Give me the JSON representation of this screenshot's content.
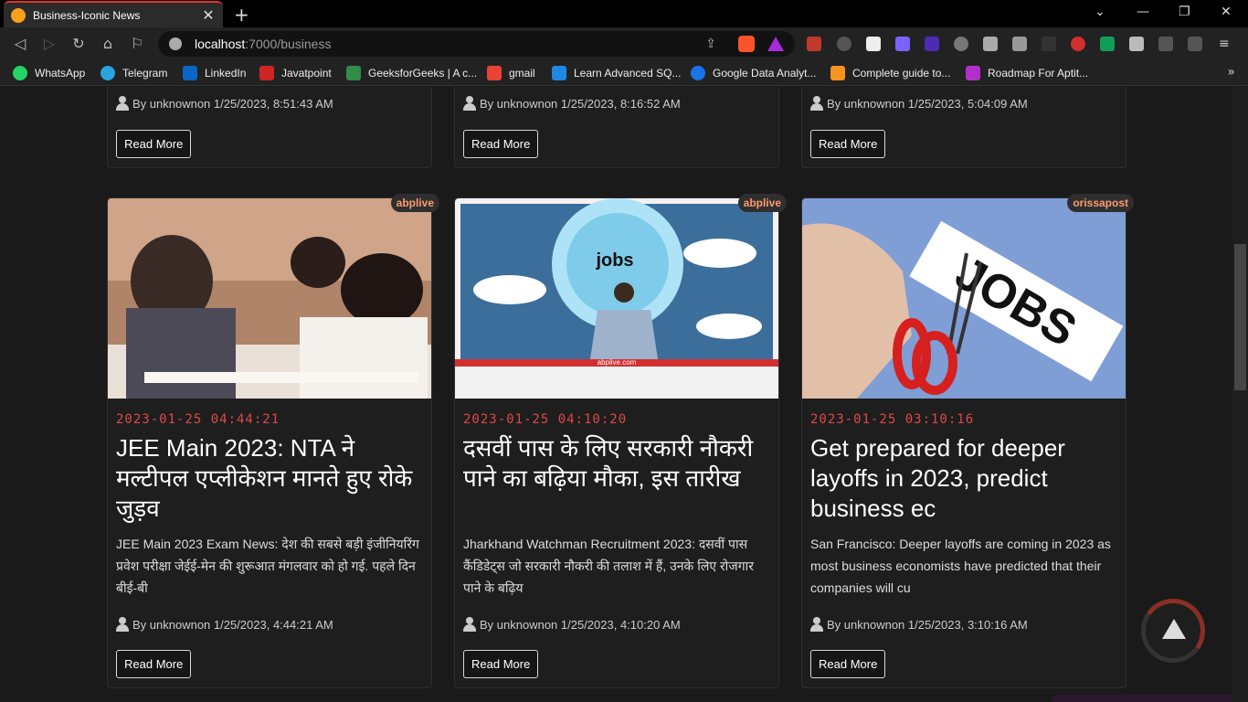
{
  "browser": {
    "tab_title": "Business-Iconic News",
    "url_host": "localhost",
    "url_path": ":7000/business",
    "bookmarks": [
      {
        "label": "WhatsApp",
        "color": "#25d366"
      },
      {
        "label": "Telegram",
        "color": "#2aa3e0"
      },
      {
        "label": "LinkedIn",
        "color": "#0a66c2"
      },
      {
        "label": "Javatpoint",
        "color": "#d02424"
      },
      {
        "label": "GeeksforGeeks | A c...",
        "color": "#2f8d46"
      },
      {
        "label": "gmail",
        "color": "#ea4335"
      },
      {
        "label": "Learn Advanced SQ...",
        "color": "#1e88e5"
      },
      {
        "label": "Google Data Analyt...",
        "color": "#1a73e8"
      },
      {
        "label": "Complete guide to...",
        "color": "#f7931e"
      },
      {
        "label": "Roadmap For Aptit...",
        "color": "#b22fc9"
      }
    ]
  },
  "top_cards": [
    {
      "byline": "By unknownon 1/25/2023, 8:51:43 AM",
      "button": "Read More"
    },
    {
      "byline": "By unknownon 1/25/2023, 8:16:52 AM",
      "button": "Read More"
    },
    {
      "byline": "By unknownon 1/25/2023, 5:04:09 AM",
      "button": "Read More"
    }
  ],
  "cards": [
    {
      "source": "abplive",
      "date": "2023-01-25 04:44:21",
      "title": "JEE Main 2023: NTA ने मल्टीपल एप्लीकेशन मानते हुए रोके जुड़व",
      "description": "JEE Main 2023 Exam News: देश की सबसे बड़ी इंजीनियरिंग प्रवेश परीक्षा जेईई-मेन की शुरूआत मंगलवार को हो गई. पहले दिन बीई-बी",
      "byline": "By unknownon 1/25/2023, 4:44:21 AM",
      "button": "Read More"
    },
    {
      "source": "abplive",
      "date": "2023-01-25 04:10:20",
      "title": "दसवीं पास के लिए सरकारी नौकरी पाने का बढ़िया मौका, इस तारीख",
      "description": "Jharkhand Watchman Recruitment 2023: दसवीं पास कैंडिडेट्स जो सरकारी नौकरी की तलाश में हैं, उनके लिए रोजगार पाने के बढ़िय",
      "byline": "By unknownon 1/25/2023, 4:10:20 AM",
      "button": "Read More",
      "image_text": "jobs",
      "image_caption": "abplive.com"
    },
    {
      "source": "orissapost",
      "date": "2023-01-25 03:10:16",
      "title": "Get prepared for deeper layoffs in 2023, predict business ec",
      "description": "San Francisco: Deeper layoffs are coming in 2023 as most business economists have predicted that their companies will cu",
      "byline": "By unknownon 1/25/2023, 3:10:16 AM",
      "button": "Read More",
      "image_text": "JOBS"
    }
  ]
}
